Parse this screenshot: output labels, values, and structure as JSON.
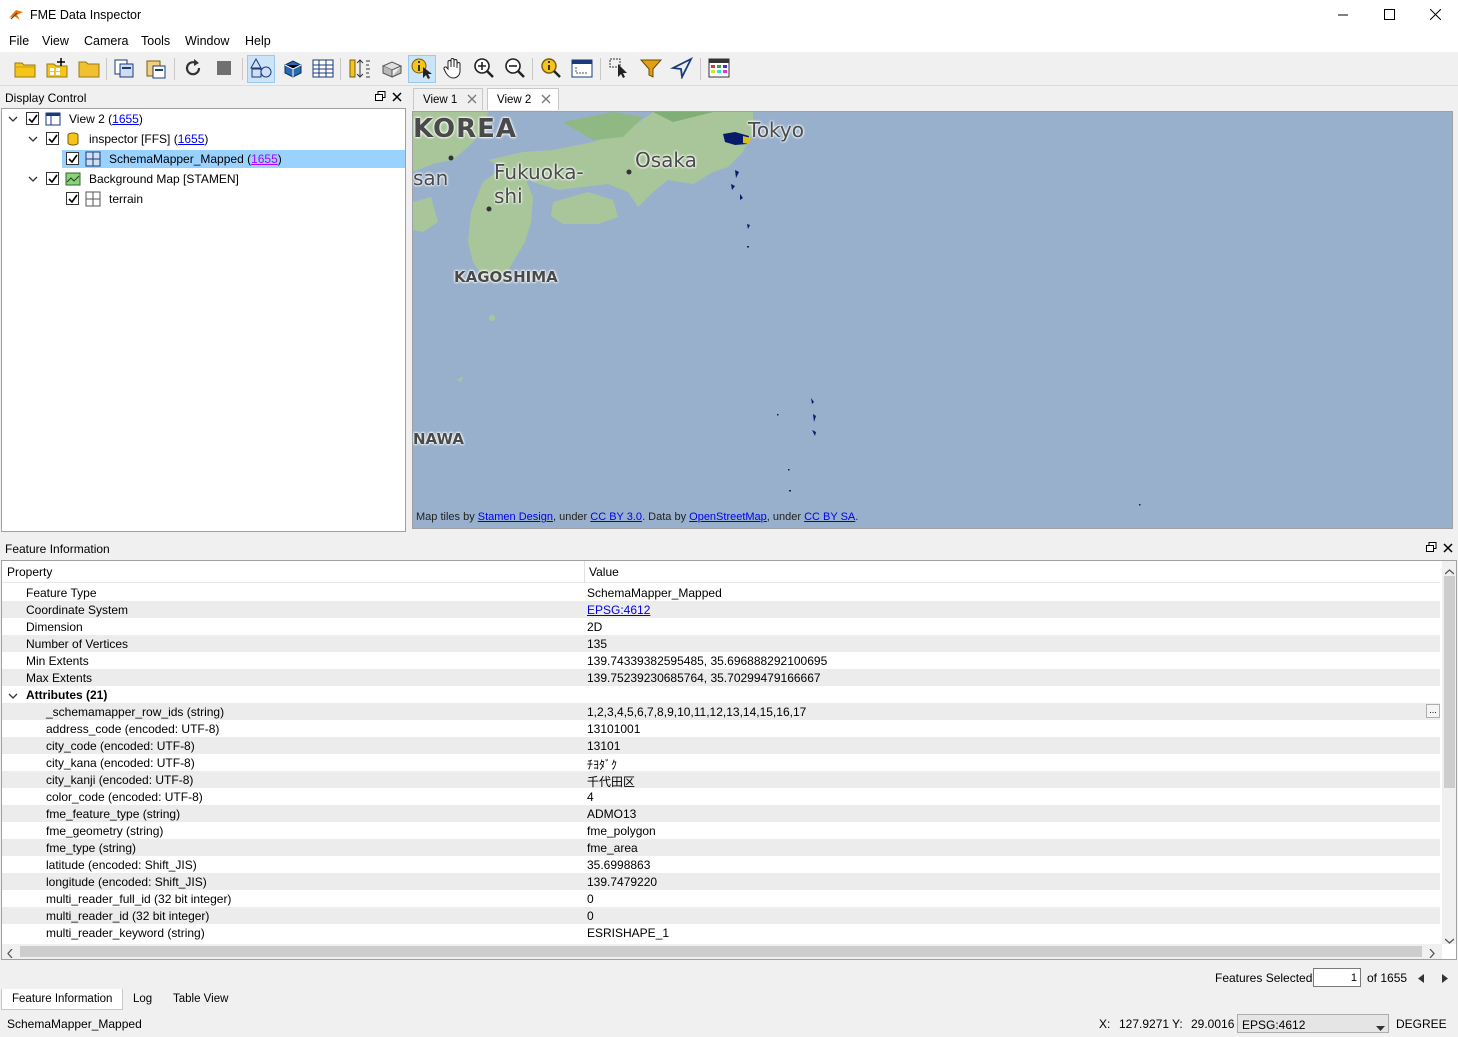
{
  "window": {
    "title": "FME Data Inspector",
    "minimize_icon": "minimize-icon",
    "maximize_icon": "maximize-icon",
    "close_icon": "close-icon"
  },
  "menu": [
    "File",
    "View",
    "Camera",
    "Tools",
    "Window",
    "Help"
  ],
  "toolbar_icons": [
    "open-dataset-icon",
    "add-dataset-icon",
    "open-folder-icon",
    "copy-icon",
    "paste-icon",
    "refresh-icon",
    "stop-icon",
    "2d-view-icon",
    "3d-view-icon",
    "table-view-icon",
    "orthogonal-icon",
    "background-map-icon",
    "select-icon",
    "pan-icon",
    "zoom-in-icon",
    "zoom-out-icon",
    "zoom-extents-icon",
    "zoom-window-icon",
    "select-features-icon",
    "filter-icon",
    "navigate-icon",
    "background-color-icon"
  ],
  "display_control": {
    "title": "Display Control",
    "tree": [
      {
        "label": "View 2 (",
        "count": "1655",
        "close": ")"
      },
      {
        "label": "inspector [FFS] (",
        "count": "1655",
        "close": ")"
      },
      {
        "label": "SchemaMapper_Mapped (",
        "count": "1655",
        "close": ")"
      },
      {
        "label": "Background Map [STAMEN]"
      },
      {
        "label": "terrain"
      }
    ]
  },
  "view_tabs": [
    "View 1",
    "View 2"
  ],
  "map": {
    "labels": [
      "KOREA",
      "Tokyo",
      "Fukuoka-",
      "shi",
      "Osaka",
      "san",
      "KAGOSHIMA",
      "NAWA"
    ],
    "attribution": {
      "p1": "Map tiles by ",
      "l1": "Stamen Design",
      "p2": ", under ",
      "l2": "CC BY 3.0",
      "p3": ". Data by ",
      "l3": "OpenStreetMap",
      "p4": ", under ",
      "l4": "CC BY SA",
      "p5": "."
    },
    "colors": {
      "sea": "#98b0cc",
      "land": "#a8c69a",
      "feature": "#0a1a6a"
    }
  },
  "feature_info": {
    "title": "Feature Information",
    "col_property": "Property",
    "col_value": "Value",
    "rows": [
      {
        "p": "Feature Type",
        "v": "SchemaMapper_Mapped"
      },
      {
        "p": "Coordinate System",
        "v": "EPSG:4612"
      },
      {
        "p": "Dimension",
        "v": "2D"
      },
      {
        "p": "Number of Vertices",
        "v": "135"
      },
      {
        "p": "Min Extents",
        "v": "139.74339382595485, 35.696888292100695"
      },
      {
        "p": "Max Extents",
        "v": "139.75239230685764, 35.70299479166667"
      },
      {
        "p": "Attributes (21)",
        "v": ""
      },
      {
        "p": "_schemamapper_row_ids (string)",
        "v": "1,2,3,4,5,6,7,8,9,10,11,12,13,14,15,16,17",
        "more": "..."
      },
      {
        "p": "address_code (encoded: UTF-8)",
        "v": "13101001"
      },
      {
        "p": "city_code (encoded: UTF-8)",
        "v": "13101"
      },
      {
        "p": "city_kana (encoded: UTF-8)",
        "v": "ﾁﾖﾀﾞｸ"
      },
      {
        "p": "city_kanji (encoded: UTF-8)",
        "v": "千代田区"
      },
      {
        "p": "color_code (encoded: UTF-8)",
        "v": "4"
      },
      {
        "p": "fme_feature_type (string)",
        "v": "ADMO13"
      },
      {
        "p": "fme_geometry (string)",
        "v": "fme_polygon"
      },
      {
        "p": "fme_type (string)",
        "v": "fme_area"
      },
      {
        "p": "latitude (encoded: Shift_JIS)",
        "v": "35.6998863"
      },
      {
        "p": "longitude (encoded: Shift_JIS)",
        "v": "139.7479220"
      },
      {
        "p": "multi_reader_full_id (32 bit integer)",
        "v": "0"
      },
      {
        "p": "multi_reader_id (32 bit integer)",
        "v": "0"
      },
      {
        "p": "multi_reader_keyword (string)",
        "v": "ESRISHAPE_1"
      }
    ]
  },
  "footer": {
    "features_selected_label": "Features Selected:",
    "features_selected_value": "1",
    "of_total": "of 1655"
  },
  "bottom_tabs": [
    "Feature Information",
    "Log",
    "Table View"
  ],
  "status": {
    "feature_type": "SchemaMapper_Mapped",
    "x_label": "X:",
    "x_value": "127.9271",
    "y_label": "Y:",
    "y_value": "29.0016",
    "crs": "EPSG:4612",
    "units": "DEGREE"
  }
}
